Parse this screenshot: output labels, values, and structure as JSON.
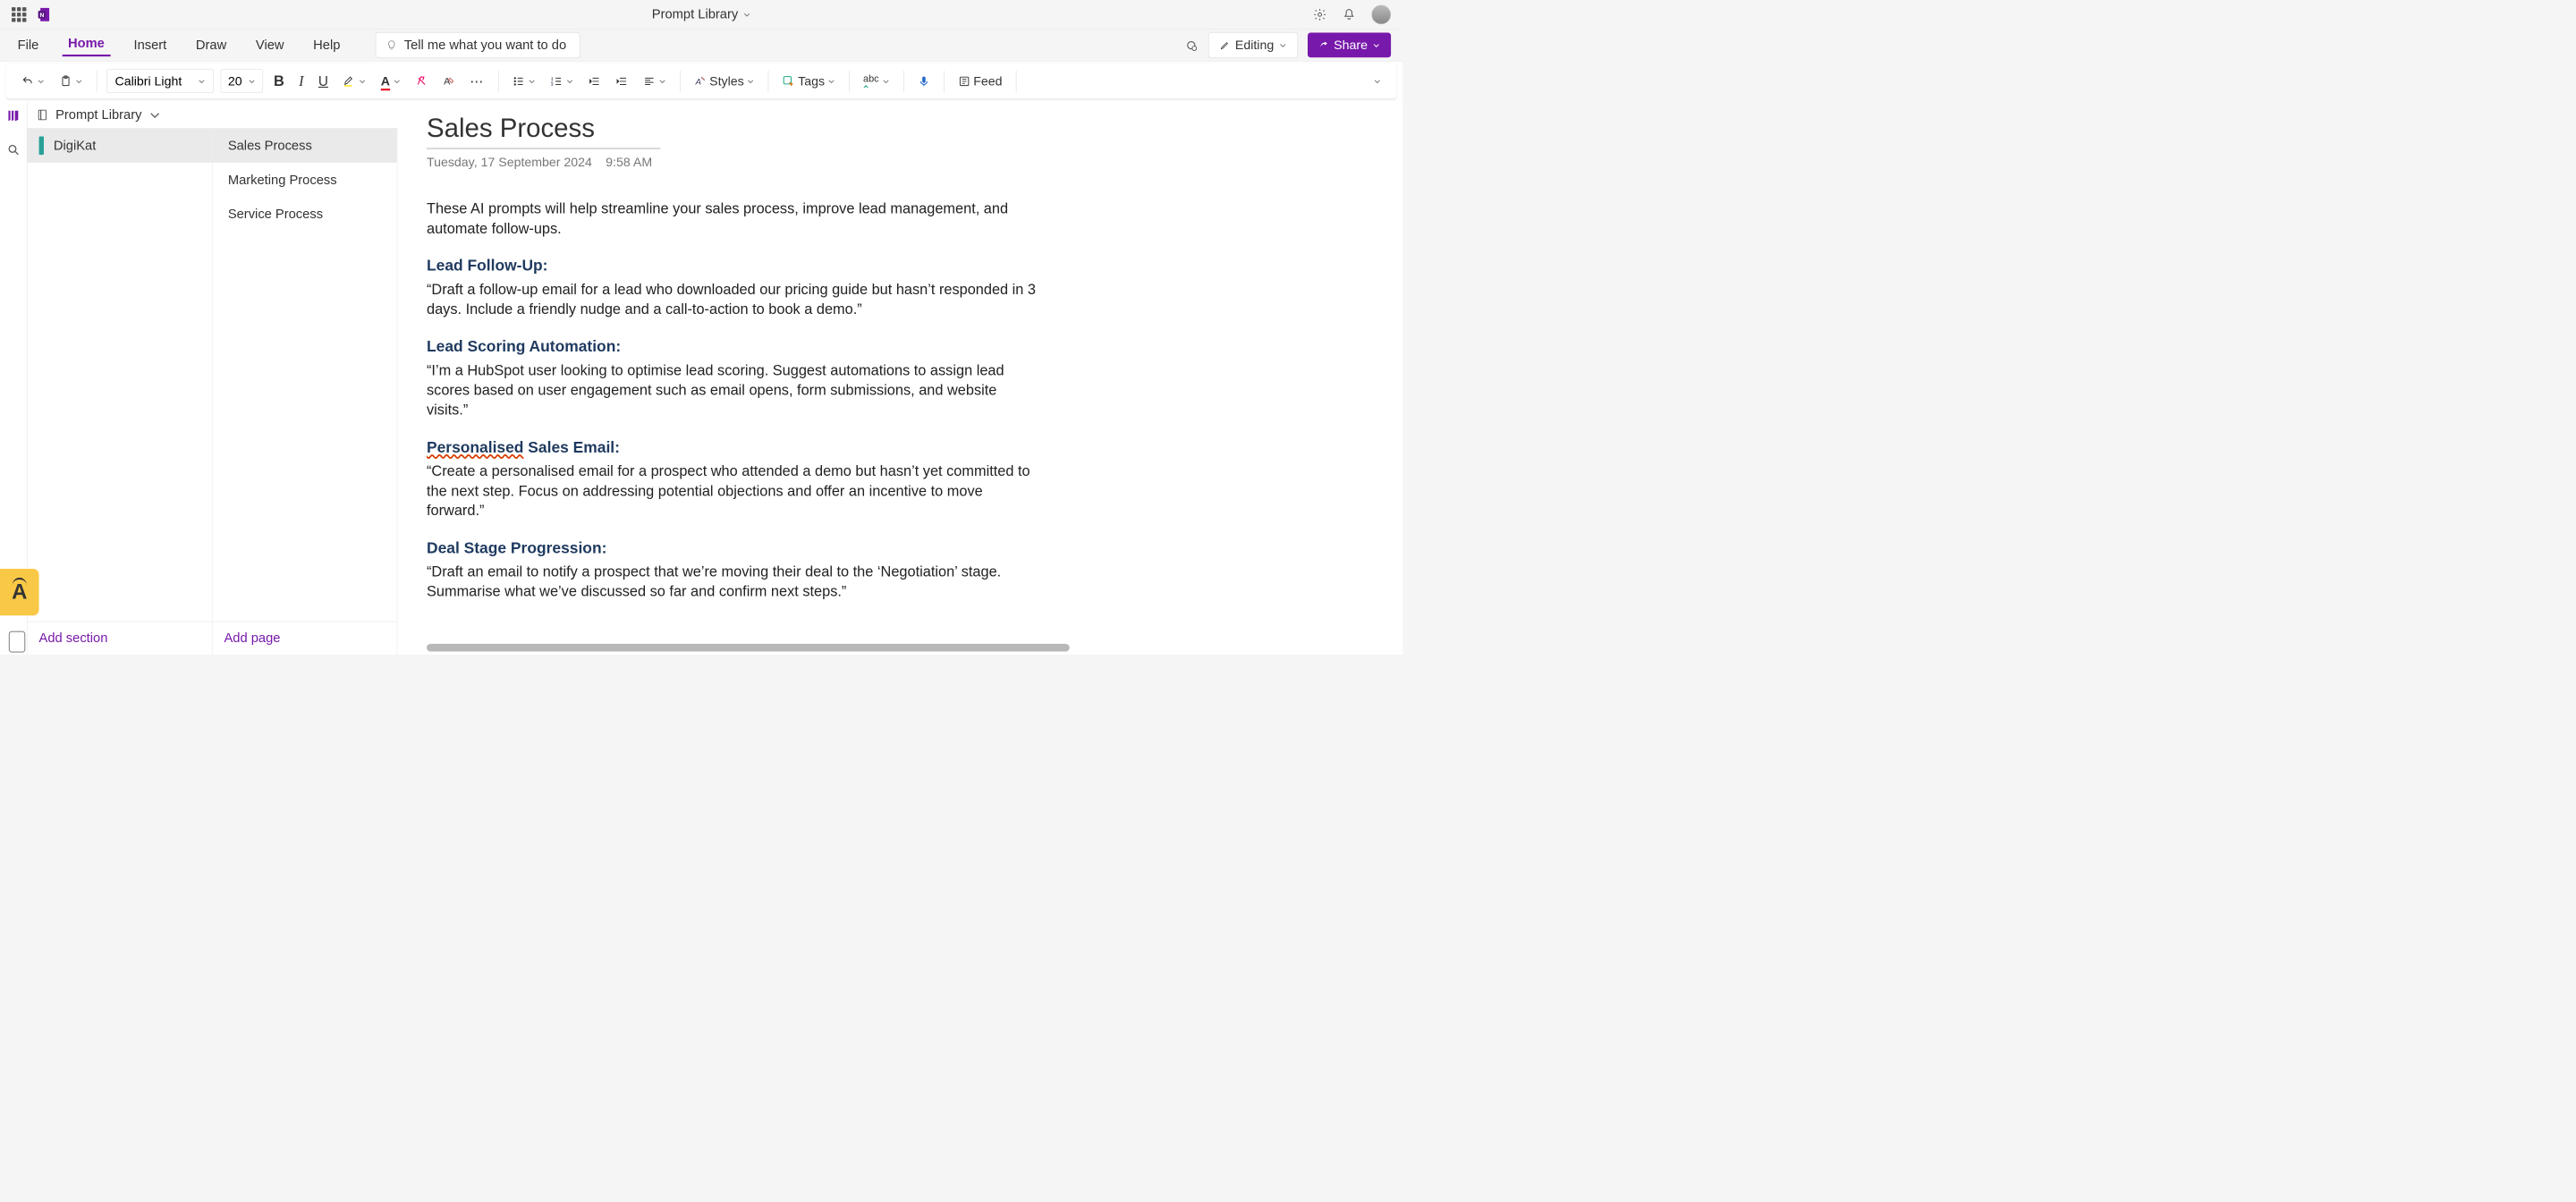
{
  "titlebar": {
    "notebook_title": "Prompt Library"
  },
  "menu": {
    "items": [
      "File",
      "Home",
      "Insert",
      "Draw",
      "View",
      "Help"
    ],
    "active_index": 1,
    "tellme_placeholder": "Tell me what you want to do",
    "editing_label": "Editing",
    "share_label": "Share"
  },
  "ribbon": {
    "font_name": "Calibri Light",
    "font_size": "20",
    "styles_label": "Styles",
    "tags_label": "Tags",
    "feed_label": "Feed"
  },
  "notebook": {
    "name": "Prompt Library"
  },
  "sections": {
    "items": [
      {
        "label": "DigiKat",
        "active": true
      }
    ],
    "add_label": "Add section"
  },
  "pages": {
    "items": [
      {
        "label": "Sales Process",
        "active": true
      },
      {
        "label": "Marketing Process",
        "active": false
      },
      {
        "label": "Service Process",
        "active": false
      }
    ],
    "add_label": "Add page"
  },
  "page": {
    "title": "Sales Process",
    "date": "Tuesday, 17 September 2024",
    "time": "9:58 AM",
    "intro": "These AI prompts will help streamline your sales process, improve lead management, and automate follow-ups.",
    "sections": [
      {
        "heading": "Lead Follow-Up:",
        "body": "“Draft a follow-up email for a lead who downloaded our pricing guide but hasn’t responded in 3 days. Include a friendly nudge and a call-to-action to book a demo.”"
      },
      {
        "heading": "Lead Scoring Automation:",
        "body": "“I’m a HubSpot user looking to optimise lead scoring. Suggest automations to assign lead scores based on user engagement such as email opens, form submissions, and website visits.”"
      },
      {
        "heading": "Personalised Sales Email:",
        "spell": "Personalised",
        "rest": " Sales Email:",
        "body": "“Create a personalised email for a prospect who attended a demo but hasn’t yet committed to the next step. Focus on addressing potential objections and offer an incentive to move forward.”"
      },
      {
        "heading": "Deal Stage Progression:",
        "body": "“Draft an email to notify a prospect that we’re moving their deal to the ‘Negotiation’ stage. Summarise what we’ve discussed so far and confirm next steps.”"
      }
    ]
  }
}
